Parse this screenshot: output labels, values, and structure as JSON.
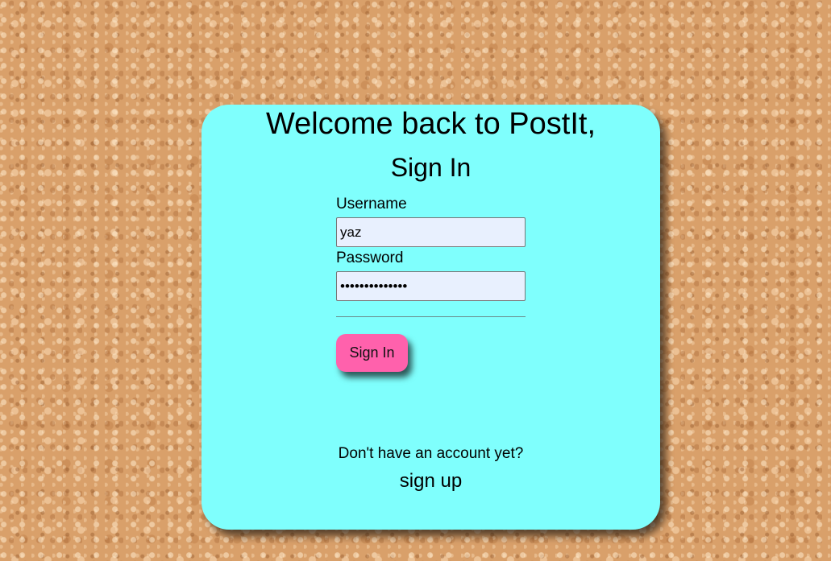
{
  "card": {
    "title": "Welcome back to PostIt,",
    "subtitle": "Sign In"
  },
  "form": {
    "username_label": "Username",
    "username_value": "yaz",
    "password_label": "Password",
    "password_value": "••••••••••••••",
    "submit_label": "Sign In"
  },
  "footer": {
    "prompt": "Don't have an account yet?",
    "signup_label": "sign up"
  },
  "colors": {
    "card_background": "#7ffffd",
    "button_background": "#ff61ac",
    "input_background": "#e8f0fe"
  }
}
